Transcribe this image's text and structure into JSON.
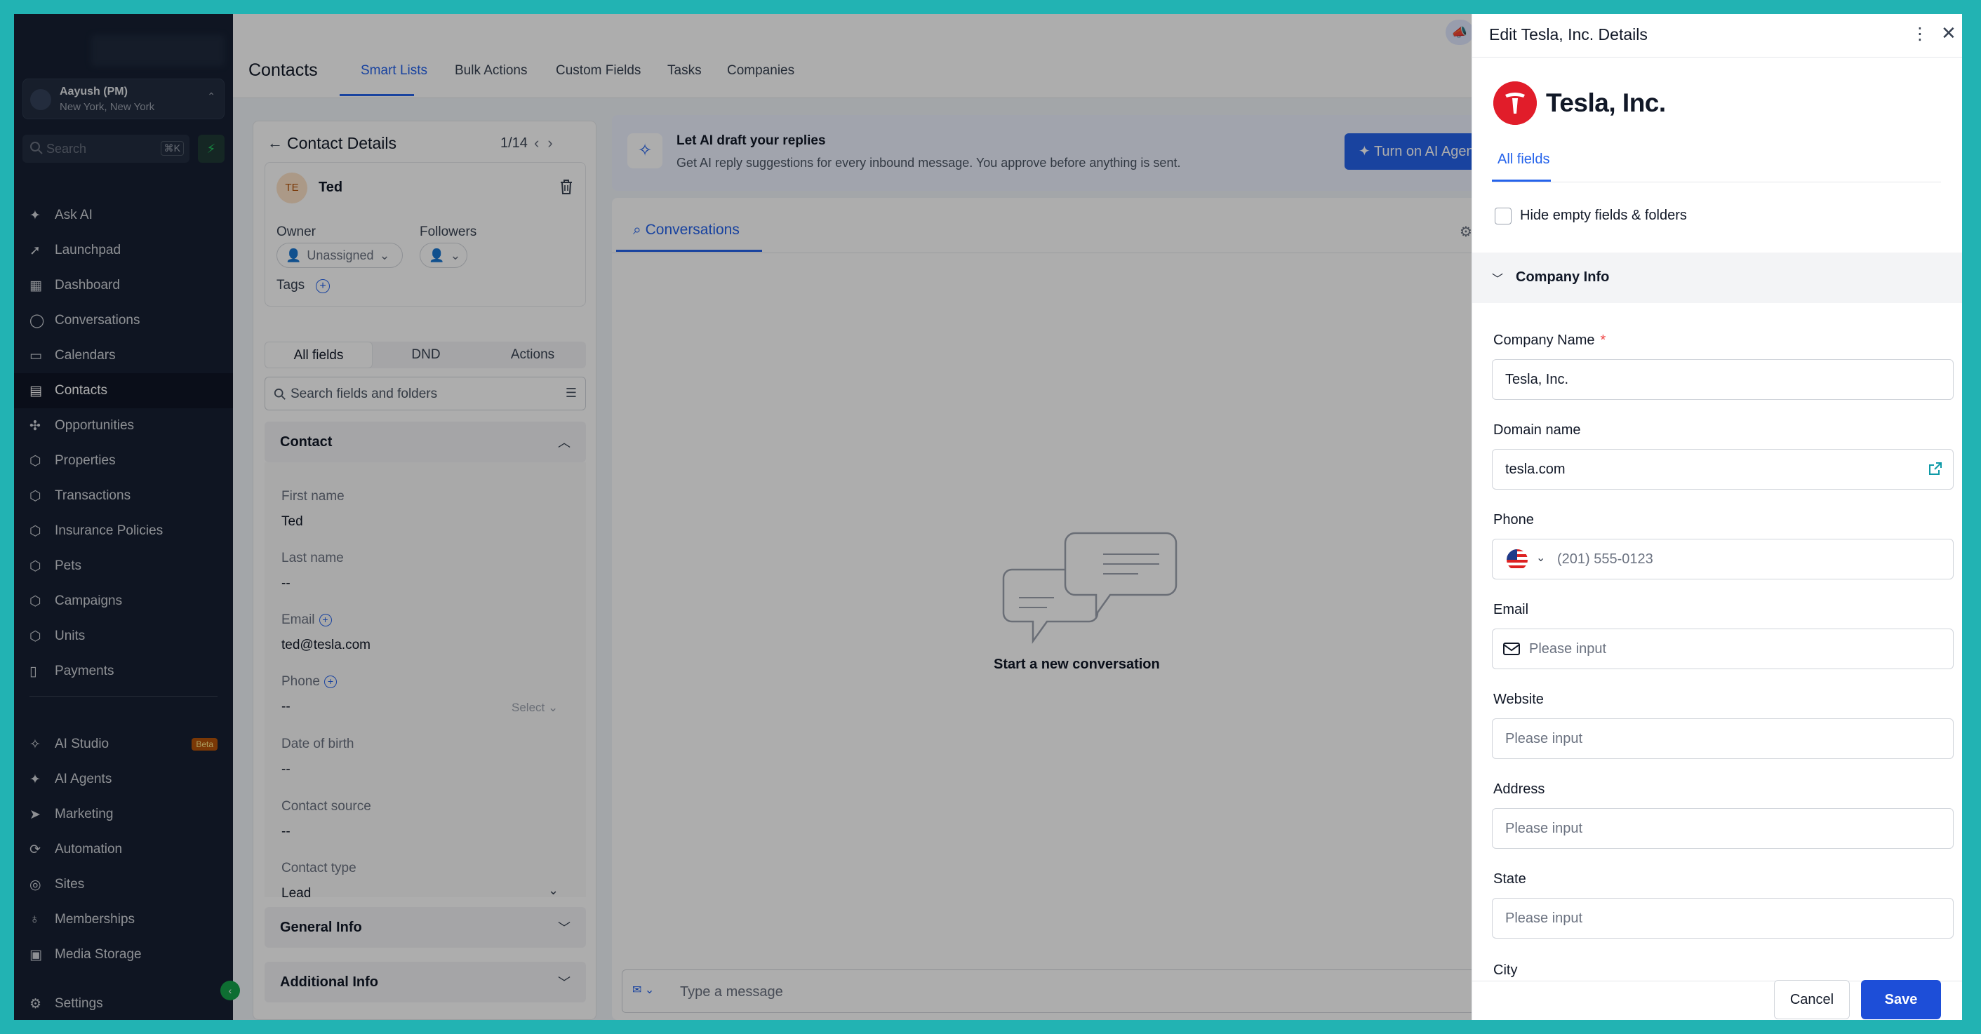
{
  "sidebar": {
    "location": {
      "name": "Aayush (PM)",
      "city": "New York, New York"
    },
    "search": {
      "placeholder": "Search",
      "shortcut": "⌘K"
    },
    "items": [
      {
        "label": "Ask AI",
        "icon": "sparkle-icon"
      },
      {
        "label": "Launchpad",
        "icon": "rocket-icon"
      },
      {
        "label": "Dashboard",
        "icon": "grid-icon"
      },
      {
        "label": "Conversations",
        "icon": "chat-icon"
      },
      {
        "label": "Calendars",
        "icon": "calendar-icon"
      },
      {
        "label": "Contacts",
        "icon": "contact-card-icon",
        "active": true
      },
      {
        "label": "Opportunities",
        "icon": "hub-icon"
      },
      {
        "label": "Properties",
        "icon": "box-icon"
      },
      {
        "label": "Transactions",
        "icon": "box-icon"
      },
      {
        "label": "Insurance Policies",
        "icon": "box-icon"
      },
      {
        "label": "Pets",
        "icon": "box-icon"
      },
      {
        "label": "Campaigns",
        "icon": "box-icon"
      },
      {
        "label": "Units",
        "icon": "box-icon"
      },
      {
        "label": "Payments",
        "icon": "receipt-icon"
      }
    ],
    "items2": [
      {
        "label": "AI Studio",
        "icon": "ai-studio-icon",
        "badge": "Beta"
      },
      {
        "label": "AI Agents",
        "icon": "sparkle-icon"
      },
      {
        "label": "Marketing",
        "icon": "send-icon"
      },
      {
        "label": "Automation",
        "icon": "automation-icon"
      },
      {
        "label": "Sites",
        "icon": "globe-icon"
      },
      {
        "label": "Memberships",
        "icon": "award-icon"
      },
      {
        "label": "Media Storage",
        "icon": "image-icon"
      }
    ],
    "settings": "Settings"
  },
  "topbar": {
    "title": "Contacts",
    "tabs": [
      "Smart Lists",
      "Bulk Actions",
      "Custom Fields",
      "Tasks",
      "Companies"
    ]
  },
  "contact_panel": {
    "title": "Contact Details",
    "pagination": "1/14",
    "avatar_initials": "TE",
    "name": "Ted",
    "owner_label": "Owner",
    "owner_value": "Unassigned",
    "followers_label": "Followers",
    "tags_label": "Tags",
    "tabs": [
      "All fields",
      "DND",
      "Actions"
    ],
    "search_placeholder": "Search fields and folders",
    "section_contact": "Contact",
    "fields": {
      "first_name_label": "First name",
      "first_name": "Ted",
      "last_name_label": "Last name",
      "last_name": "--",
      "email_label": "Email",
      "email": "ted@tesla.com",
      "phone_label": "Phone",
      "phone": "--",
      "phone_select": "Select",
      "dob_label": "Date of birth",
      "dob": "--",
      "source_label": "Contact source",
      "source": "--",
      "type_label": "Contact type",
      "type": "Lead"
    },
    "section_general": "General Info",
    "section_additional": "Additional Info"
  },
  "ai_banner": {
    "title": "Let AI draft your replies",
    "subtitle": "Get AI reply suggestions for every inbound message. You approve before anything is sent.",
    "button": "Turn on AI Agent"
  },
  "conversation": {
    "tab": "Conversations",
    "empty": "Start a new conversation",
    "input_placeholder": "Type a message"
  },
  "drawer": {
    "title": "Edit Tesla, Inc. Details",
    "company": "Tesla, Inc.",
    "tab": "All fields",
    "hide_empty": "Hide empty fields & folders",
    "section": "Company Info",
    "fields": [
      {
        "label": "Company Name",
        "required": "*",
        "value": "Tesla, Inc."
      },
      {
        "label": "Domain name",
        "value": "tesla.com"
      },
      {
        "label": "Phone",
        "placeholder": "(201) 555-0123"
      },
      {
        "label": "Email",
        "placeholder": "Please input"
      },
      {
        "label": "Website",
        "placeholder": "Please input"
      },
      {
        "label": "Address",
        "placeholder": "Please input"
      },
      {
        "label": "State",
        "placeholder": "Please input"
      },
      {
        "label": "City"
      }
    ],
    "cancel": "Cancel",
    "save": "Save"
  },
  "colors": {
    "accent": "#2563eb",
    "sidebar": "#172033",
    "tesla_red": "#e11d2a",
    "frame": "#22b3b3"
  }
}
